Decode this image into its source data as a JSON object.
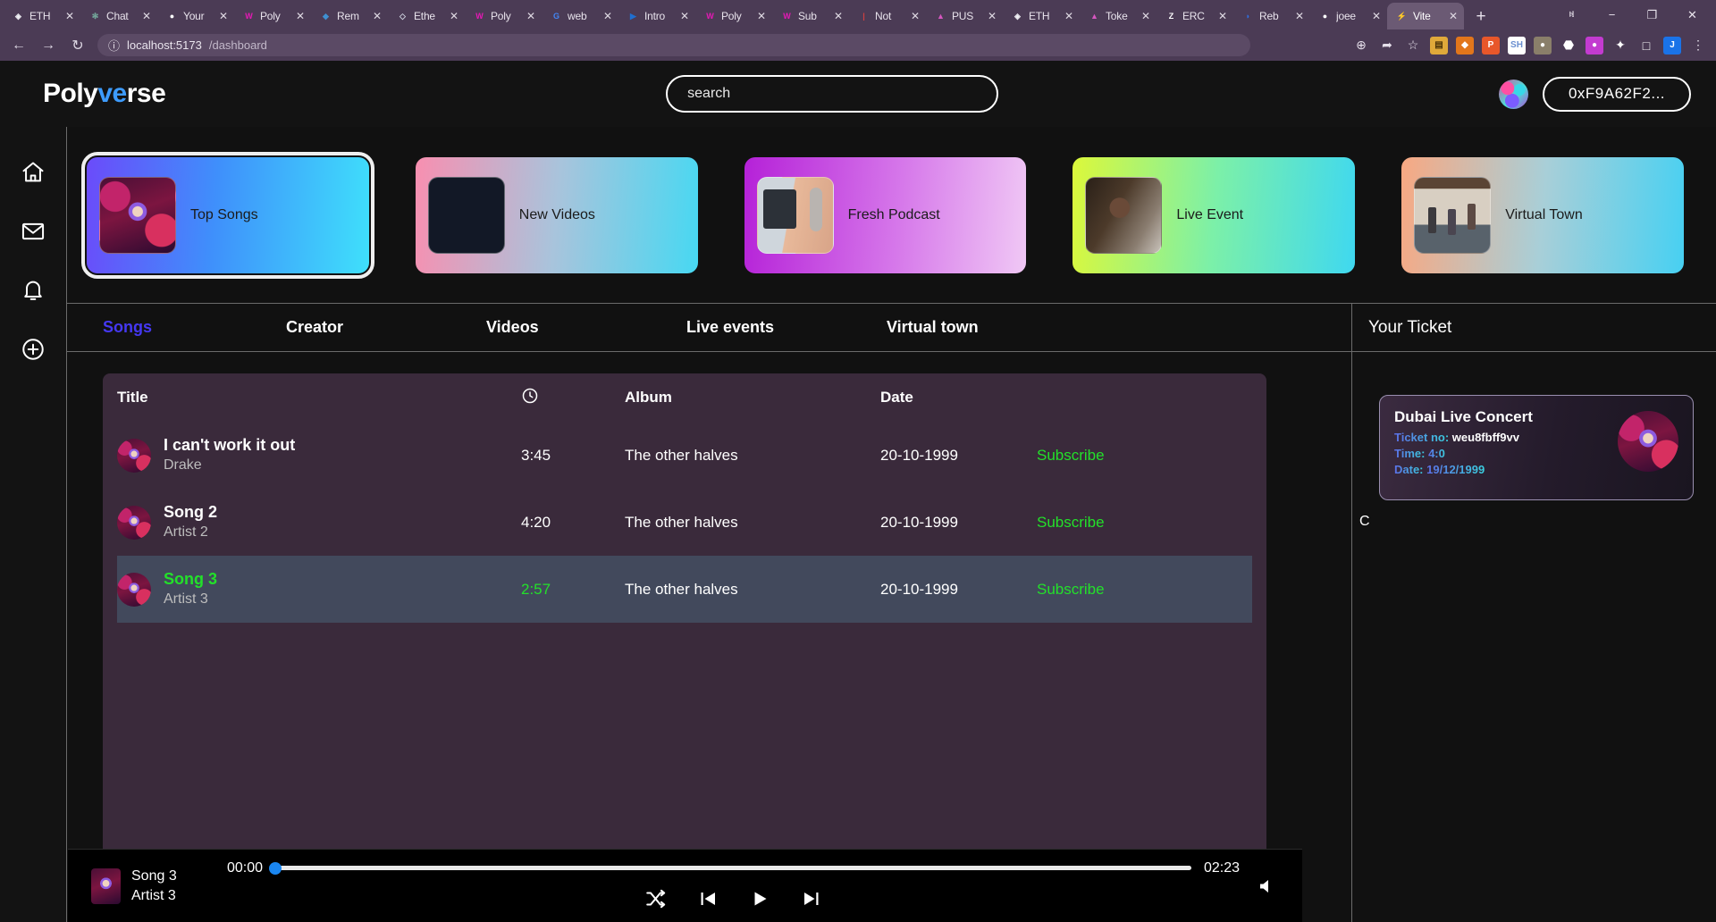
{
  "browser": {
    "tabs": [
      {
        "label": "ETH",
        "icon": "eth-icon",
        "color": "#f0f0f5",
        "glyph": "◈",
        "active": false
      },
      {
        "label": "Chat",
        "icon": "chatgpt-icon",
        "color": "#74aa9c",
        "glyph": "✻",
        "active": false
      },
      {
        "label": "Your",
        "icon": "github-icon",
        "color": "#ffffff",
        "glyph": "●",
        "active": false
      },
      {
        "label": "Poly",
        "icon": "polyverse-icon",
        "color": "#e618b6",
        "glyph": "W",
        "active": false
      },
      {
        "label": "Rem",
        "icon": "remix-icon",
        "color": "#3f8fd0",
        "glyph": "◆",
        "active": false
      },
      {
        "label": "Ethe",
        "icon": "ethers-icon",
        "color": "#cfd4e0",
        "glyph": "◇",
        "active": false
      },
      {
        "label": "Poly",
        "icon": "polyverse-icon",
        "color": "#e618b6",
        "glyph": "W",
        "active": false
      },
      {
        "label": "web",
        "icon": "google-icon",
        "color": "#4285f4",
        "glyph": "G",
        "active": false
      },
      {
        "label": "Intro",
        "icon": "video-icon",
        "color": "#1f6fd0",
        "glyph": "▶",
        "active": false
      },
      {
        "label": "Poly",
        "icon": "polyverse-icon",
        "color": "#e618b6",
        "glyph": "W",
        "active": false
      },
      {
        "label": "Sub",
        "icon": "polyverse-icon",
        "color": "#e618b6",
        "glyph": "W",
        "active": false
      },
      {
        "label": "Not",
        "icon": "notion-icon",
        "color": "#d04040",
        "glyph": "|",
        "active": false
      },
      {
        "label": "PUS",
        "icon": "push-icon",
        "color": "#d657c0",
        "glyph": "▲",
        "active": false
      },
      {
        "label": "ETH",
        "icon": "eth-icon",
        "color": "#f0f0f5",
        "glyph": "◈",
        "active": false
      },
      {
        "label": "Toke",
        "icon": "push-icon",
        "color": "#d657c0",
        "glyph": "▲",
        "active": false
      },
      {
        "label": "ERC",
        "icon": "zora-icon",
        "color": "#ffffff",
        "glyph": "Z",
        "active": false
      },
      {
        "label": "Reb",
        "icon": "rebase-icon",
        "color": "#2f6fe0",
        "glyph": "◗",
        "active": false
      },
      {
        "label": "joee",
        "icon": "github-icon",
        "color": "#ffffff",
        "glyph": "●",
        "active": false
      },
      {
        "label": "Vite",
        "icon": "vite-icon",
        "color": "#ffffff",
        "glyph": "⚡",
        "active": true
      }
    ],
    "newtab_label": "+",
    "close_glyph": "✕",
    "window_controls": [
      "ⱝ",
      "−",
      "❐",
      "✕"
    ],
    "nav": {
      "back": "←",
      "forward": "→",
      "reload": "↻",
      "info": "ⓘ"
    },
    "url_host": "localhost:5173",
    "url_path": "/dashboard",
    "toolbar_icons": [
      {
        "name": "zoom-icon",
        "glyph": "⊕",
        "bg": "transparent",
        "fg": "#e5dfea"
      },
      {
        "name": "share-icon",
        "glyph": "➦",
        "bg": "transparent",
        "fg": "#e5dfea"
      },
      {
        "name": "bookmark-star-icon",
        "glyph": "☆",
        "bg": "transparent",
        "fg": "#e5dfea"
      },
      {
        "name": "wallet-extension-icon",
        "glyph": "▤",
        "bg": "#e0a93a",
        "fg": "#4a3208"
      },
      {
        "name": "metamask-icon",
        "glyph": "◆",
        "bg": "#e2761b",
        "fg": "#ffffff"
      },
      {
        "name": "pdf-extension-icon",
        "glyph": "P",
        "bg": "#e8572a",
        "fg": "#ffffff"
      },
      {
        "name": "sh-extension-icon",
        "glyph": "SH",
        "bg": "#ffffff",
        "fg": "#6b8fd0"
      },
      {
        "name": "profile-extension-icon",
        "glyph": "●",
        "bg": "#8a7f6a",
        "fg": "#ffffff"
      },
      {
        "name": "dark-extension-icon",
        "glyph": "⬣",
        "bg": "transparent",
        "fg": "#ffffff"
      },
      {
        "name": "purple-extension-icon",
        "glyph": "●",
        "bg": "#c33bd0",
        "fg": "#ffffff"
      },
      {
        "name": "puzzle-extension-icon",
        "glyph": "✦",
        "bg": "transparent",
        "fg": "#ffffff"
      },
      {
        "name": "sidebar-icon",
        "glyph": "□",
        "bg": "transparent",
        "fg": "#ffffff"
      },
      {
        "name": "profile-avatar-icon",
        "glyph": "J",
        "bg": "#1a73e8",
        "fg": "#ffffff"
      },
      {
        "name": "more-menu-icon",
        "glyph": "⋮",
        "bg": "transparent",
        "fg": "#e5dfea"
      }
    ]
  },
  "app": {
    "logo": {
      "prefix": "Poly",
      "accent": "ve",
      "suffix": "rse"
    },
    "search": {
      "placeholder": "search",
      "value": ""
    },
    "wallet": {
      "address": "0xF9A62F2..."
    },
    "sidebar": [
      {
        "name": "home-icon",
        "label": "Home"
      },
      {
        "name": "mail-icon",
        "label": "Mail"
      },
      {
        "name": "bell-icon",
        "label": "Notifications"
      },
      {
        "name": "plus-circle-icon",
        "label": "Create"
      }
    ],
    "cards": [
      {
        "label": "Top Songs",
        "thumb": "thumb-songs",
        "selected": true,
        "gradient": "linear-gradient(95deg,#6b4bfa 0%,#3f8ffb 45%,#3fe0fb 100%)"
      },
      {
        "label": "New Videos",
        "thumb": "thumb-video",
        "selected": false,
        "gradient": "linear-gradient(95deg,#f88fb0 0%,#a8c4dc 50%,#47d8f2 100%)"
      },
      {
        "label": "Fresh Podcast",
        "thumb": "thumb-podcast",
        "selected": false,
        "gradient": "linear-gradient(95deg,#b521d8 0%,#d678ea 55%,#f0c8f5 100%)"
      },
      {
        "label": "Live Event",
        "thumb": "thumb-live",
        "selected": false,
        "gradient": "linear-gradient(95deg,#dcf83a 0%,#7cf0a8 50%,#3fd8f0 100%)"
      },
      {
        "label": "Virtual Town",
        "thumb": "thumb-town",
        "selected": false,
        "gradient": "linear-gradient(95deg,#f8a882 0%,#a8cfd8 50%,#47d0f2 100%)"
      }
    ],
    "main_tabs": [
      {
        "label": "Songs",
        "active": true
      },
      {
        "label": "Creator",
        "active": false
      },
      {
        "label": "Videos",
        "active": false
      },
      {
        "label": "Live events",
        "active": false
      },
      {
        "label": "Virtual town",
        "active": false
      }
    ],
    "table": {
      "headers": {
        "title": "Title",
        "duration": "clock-icon",
        "album": "Album",
        "date": "Date",
        "action": ""
      },
      "rows": [
        {
          "title": "I can't work it out",
          "artist": "Drake",
          "duration": "3:45",
          "album": "The other halves",
          "date": "20-10-1999",
          "action": "Subscribe",
          "playing": false
        },
        {
          "title": "Song 2",
          "artist": "Artist 2",
          "duration": "4:20",
          "album": "The other halves",
          "date": "20-10-1999",
          "action": "Subscribe",
          "playing": false
        },
        {
          "title": "Song 3",
          "artist": "Artist 3",
          "duration": "2:57",
          "album": "The other halves",
          "date": "20-10-1999",
          "action": "Subscribe",
          "playing": true
        }
      ]
    },
    "ticket_panel": {
      "heading": "Your Ticket",
      "stray_text": "C",
      "ticket": {
        "title": "Dubai Live Concert",
        "ticket_no_label": "Ticket no:",
        "ticket_no_value": "weu8fbff9vv",
        "time_label": "Time:",
        "time_value": "4:0",
        "date_label": "Date:",
        "date_value": "19/12/1999"
      }
    },
    "player": {
      "title": "Song 3",
      "artist": "Artist 3",
      "current_time": "00:00",
      "total_time": "02:23",
      "progress_percent": 0,
      "controls": [
        {
          "name": "shuffle-icon",
          "label": "Shuffle"
        },
        {
          "name": "previous-icon",
          "label": "Previous"
        },
        {
          "name": "play-icon",
          "label": "Play"
        },
        {
          "name": "next-icon",
          "label": "Next"
        }
      ],
      "volume_icon": "volume-icon"
    },
    "colors": {
      "accent_green": "#23e02a",
      "accent_blue": "#3d9bfc",
      "active_tab": "#4538f2",
      "panel": "#3a2a3b",
      "playing_row": "#42495c"
    }
  }
}
